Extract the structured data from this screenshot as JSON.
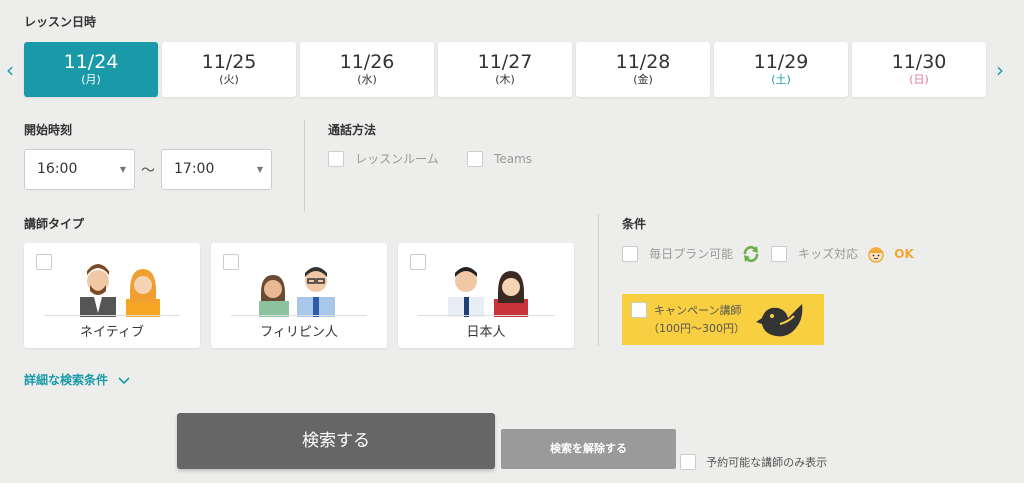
{
  "lesson_date": {
    "title": "レッスン日時",
    "dates": [
      {
        "date": "11/24",
        "weekday": "(月)",
        "selected": true
      },
      {
        "date": "11/25",
        "weekday": "(火)"
      },
      {
        "date": "11/26",
        "weekday": "(水)"
      },
      {
        "date": "11/27",
        "weekday": "(木)"
      },
      {
        "date": "11/28",
        "weekday": "(金)"
      },
      {
        "date": "11/29",
        "weekday": "(土)"
      },
      {
        "date": "11/30",
        "weekday": "(日)"
      }
    ]
  },
  "start_time": {
    "title": "開始時刻",
    "from": "16:00",
    "separator": "〜",
    "to": "17:00"
  },
  "call_method": {
    "title": "通話方法",
    "options": [
      "レッスンルーム",
      "Teams"
    ]
  },
  "teacher_type": {
    "title": "講師タイプ",
    "options": [
      "ネイティブ",
      "フィリピン人",
      "日本人"
    ]
  },
  "conditions": {
    "title": "条件",
    "daily_plan": "毎日プラン可能",
    "kids": "キッズ対応",
    "kids_badge": "OK",
    "campaign_line1": "キャンペーン講師",
    "campaign_line2": "（100円〜300円）"
  },
  "detail_link": "詳細な検索条件",
  "buttons": {
    "search": "検索する",
    "clear": "検索を解除する"
  },
  "available_only": "予約可能な講師のみ表示",
  "colors": {
    "accent": "#1a9aa8",
    "campaign_bg": "#f8cf41",
    "kids_ok": "#f0a830",
    "daily_green": "#6bb04a"
  }
}
